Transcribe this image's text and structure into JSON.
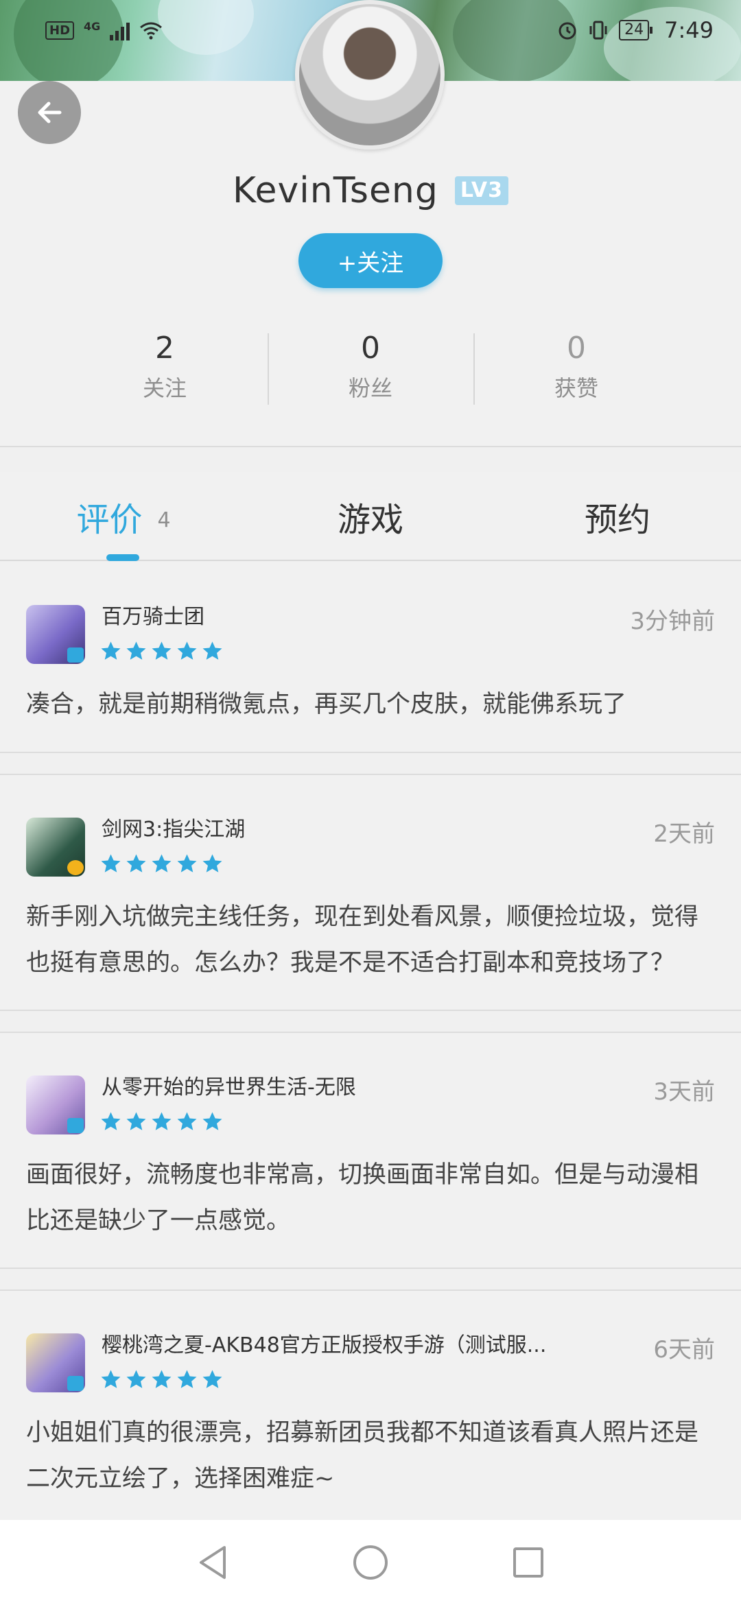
{
  "status_bar": {
    "hd": "HD",
    "network": "4G",
    "battery": "24",
    "time": "7:49"
  },
  "profile": {
    "username": "KevinTseng",
    "level": "LV3",
    "follow_label": "+关注",
    "stats": [
      {
        "value": "2",
        "label": "关注"
      },
      {
        "value": "0",
        "label": "粉丝"
      },
      {
        "value": "0",
        "label": "获赞"
      }
    ]
  },
  "tabs": [
    {
      "label": "评价",
      "count": "4",
      "active": true
    },
    {
      "label": "游戏"
    },
    {
      "label": "预约"
    }
  ],
  "reviews": [
    {
      "game": "百万骑士团",
      "rating": 5,
      "time": "3分钟前",
      "text": "凑合，就是前期稍微氪点，再买几个皮肤，就能佛系玩了",
      "icon": "game-icon-knights",
      "icon_color": "#7a6ac8"
    },
    {
      "game": "剑网3:指尖江湖",
      "rating": 5,
      "time": "2天前",
      "text": "新手刚入坑做完主线任务，现在到处看风景，顺便捡垃圾，觉得也挺有意思的。怎么办？我是不是不适合打副本和竞技场了？",
      "icon": "game-icon-jianwang",
      "icon_color": "#2f5a48"
    },
    {
      "game": "从零开始的异世界生活-无限",
      "rating": 5,
      "time": "3天前",
      "text": "画面很好，流畅度也非常高，切换画面非常自如。但是与动漫相比还是缺少了一点感觉。",
      "icon": "game-icon-rezero",
      "icon_color": "#b79ad8"
    },
    {
      "game": "樱桃湾之夏-AKB48官方正版授权手游（测试服...",
      "rating": 5,
      "time": "6天前",
      "text": "小姐姐们真的很漂亮，招募新团员我都不知道该看真人照片还是二次元立绘了，选择困难症~",
      "icon": "game-icon-akb48",
      "icon_color": "#9b8bd6"
    }
  ],
  "colors": {
    "accent": "#30a8dd",
    "background": "#f1f1f1",
    "muted_text": "#9a9a9a"
  }
}
